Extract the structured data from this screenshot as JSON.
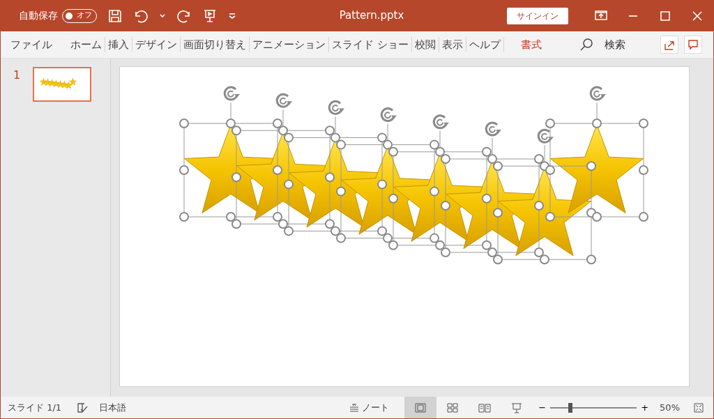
{
  "title_bar": {
    "autosave_label": "自動保存",
    "autosave_toggle": {
      "label": "オフ",
      "on": false
    },
    "title": "Pattern.pptx",
    "sign_in": "サインイン"
  },
  "ribbon_tabs": [
    {
      "label": "ファイル",
      "kind": "normal"
    },
    {
      "label": "ホーム",
      "kind": "normal"
    },
    {
      "label": "挿入",
      "kind": "normal"
    },
    {
      "label": "デザイン",
      "kind": "normal"
    },
    {
      "label": "画面切り替え",
      "kind": "normal"
    },
    {
      "label": "アニメーション",
      "kind": "normal"
    },
    {
      "label": "スライド ショー",
      "kind": "normal"
    },
    {
      "label": "校閲",
      "kind": "normal"
    },
    {
      "label": "表示",
      "kind": "normal"
    },
    {
      "label": "ヘルプ",
      "kind": "normal"
    },
    {
      "label": "書式",
      "kind": "contextual"
    }
  ],
  "search": {
    "label": "検索"
  },
  "thumbnails": [
    {
      "number": "1",
      "selected": true
    }
  ],
  "slide": {
    "all_selected": true,
    "shapes": [
      {
        "kind": "star"
      },
      {
        "kind": "star"
      },
      {
        "kind": "star"
      },
      {
        "kind": "star"
      },
      {
        "kind": "star"
      },
      {
        "kind": "star"
      },
      {
        "kind": "star"
      },
      {
        "kind": "star"
      }
    ]
  },
  "status_bar": {
    "slide_counter": "スライド 1/1",
    "language": "日本語",
    "notes": "ノート",
    "views": [
      {
        "kind": "normal",
        "selected": true
      },
      {
        "kind": "sorter",
        "selected": false
      },
      {
        "kind": "reading",
        "selected": false
      },
      {
        "kind": "slideshow",
        "selected": false
      }
    ],
    "zoom": {
      "minus": "−",
      "plus": "+",
      "level": 0.23,
      "reading": "50%"
    }
  }
}
